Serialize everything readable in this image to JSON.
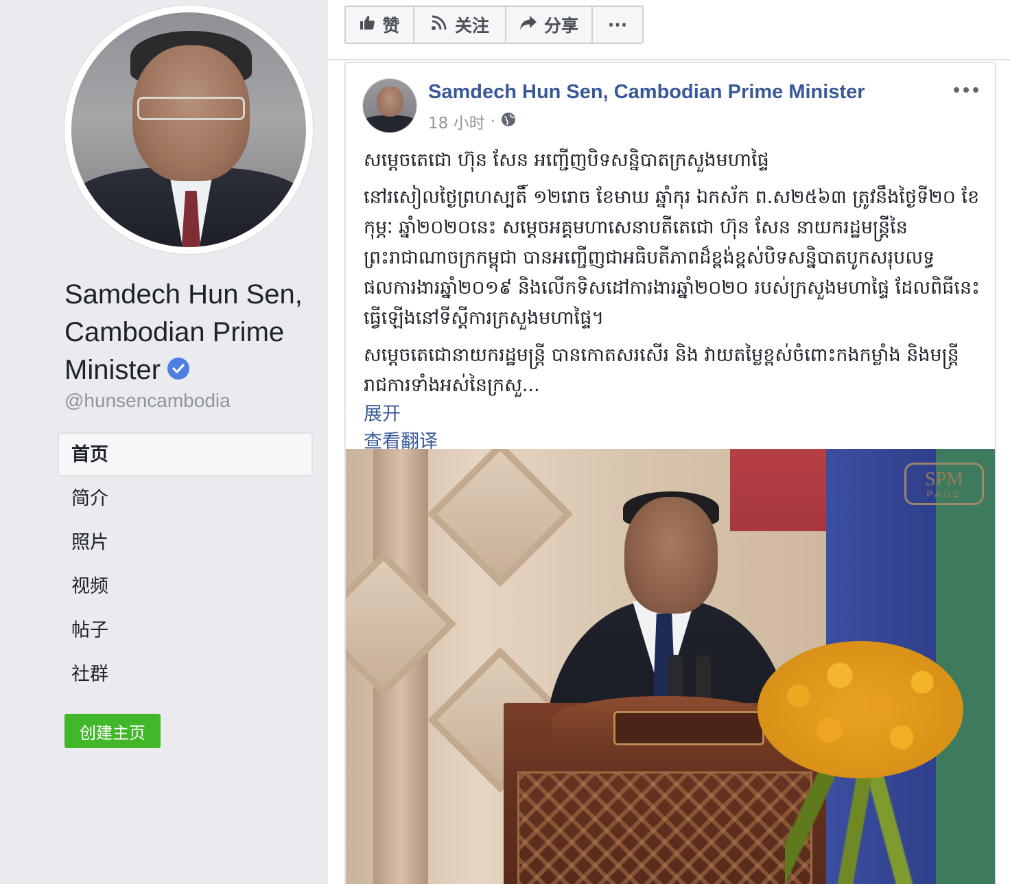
{
  "profile": {
    "name": "Samdech Hun Sen, Cambodian Prime Minister",
    "handle": "@hunsencambodia",
    "verified": true
  },
  "nav": {
    "items": [
      {
        "label": "首页",
        "active": true
      },
      {
        "label": "简介",
        "active": false
      },
      {
        "label": "照片",
        "active": false
      },
      {
        "label": "视频",
        "active": false
      },
      {
        "label": "帖子",
        "active": false
      },
      {
        "label": "社群",
        "active": false
      }
    ]
  },
  "create_page_label": "创建主页",
  "actions": {
    "like": {
      "label": "赞",
      "icon": "thumbs-up-icon"
    },
    "follow": {
      "label": "关注",
      "icon": "rss-icon"
    },
    "share": {
      "label": "分享",
      "icon": "share-arrow-icon"
    },
    "more": {
      "label": "···",
      "icon": "more-dots-icon"
    }
  },
  "post": {
    "author": "Samdech Hun Sen, Cambodian Prime Minister",
    "time": "18 小时",
    "separator": "·",
    "privacy_icon": "globe-icon",
    "paragraphs": [
      "សម្តេចតេជោ ហ៊ុន សែន អញ្ជើញបិទសន្និបាតក្រសួងមហាផ្ទៃ",
      "នៅរសៀលថ្ងៃព្រហស្បតិ៍ ១២រោច ខែមាឃ ឆ្នាំកុរ ឯកស័ក ព.ស២៥៦៣ ត្រូវនឹងថ្ងៃទី២០ ខែកុម្ភៈ ឆ្នាំ២០២០នេះ សម្តេចអគ្គមហាសេនាបតីតេជោ ហ៊ុន សែន នាយករដ្ឋមន្ត្រីនៃព្រះរាជាណាចក្រកម្ពុជា បានអញ្ជើញជាអធិបតីភាពដ៏ខ្ពង់ខ្ពស់បិទសន្និបាតបូកសរុបលទ្ធផលការងារឆ្នាំ២០១៩ និងលើកទិសដៅការងារឆ្នាំ២០២០ របស់ក្រសួងមហាផ្ទៃ ដែលពិធីនេះធ្វើឡើងនៅទីស្តីការក្រសួងមហាផ្ទៃ។",
      "សម្តេចតេជោនាយករដ្ឋមន្ត្រី បានកោតសរសើរ និង វាយតម្លៃខ្ពស់ចំពោះកងកម្លាំង និងមន្ត្រីរាជការទាំងអស់នៃក្រសួ..."
    ],
    "see_more_label": "展开",
    "translate_label": "查看翻译",
    "photo_watermark_big": "SPM",
    "photo_watermark_small": "PAGE"
  },
  "colors": {
    "link": "#385898",
    "create_button": "#42b72a",
    "verified": "#4d7fe0",
    "background": "#e9ebee"
  }
}
